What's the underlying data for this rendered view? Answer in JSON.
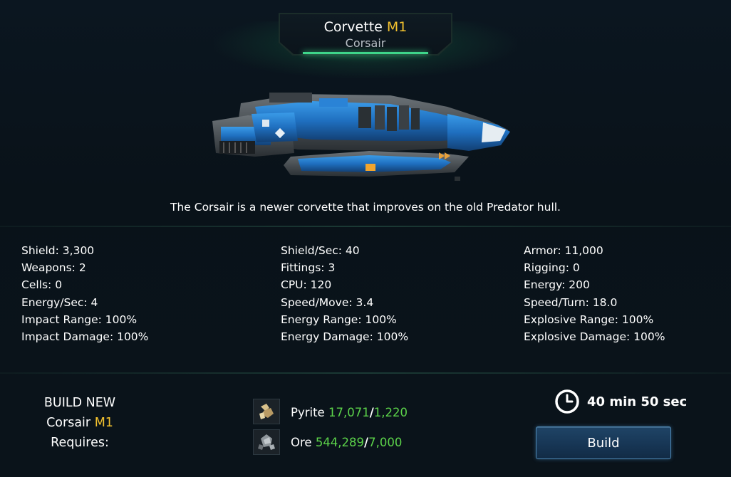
{
  "header": {
    "class_name": "Corvette",
    "mark": "M1",
    "ship_name": "Corsair"
  },
  "description": "The Corsair is a newer corvette that improves on the old Predator hull.",
  "stats": {
    "col1": [
      "Shield: 3,300",
      "Weapons: 2",
      "Cells: 0",
      "Energy/Sec: 4",
      "Impact Range: 100%",
      "Impact Damage: 100%"
    ],
    "col2": [
      "Shield/Sec: 40",
      "Fittings: 3",
      "CPU: 120",
      "Speed/Move: 3.4",
      "Energy Range: 100%",
      "Energy Damage: 100%"
    ],
    "col3": [
      "Armor: 11,000",
      "Rigging: 0",
      "Energy: 200",
      "Speed/Turn: 18.0",
      "Explosive Range: 100%",
      "Explosive Damage: 100%"
    ]
  },
  "build": {
    "line1": "BUILD NEW",
    "ship_name": "Corsair",
    "mark": "M1",
    "requires": "Requires:",
    "resources": [
      {
        "name": "Pyrite",
        "owned": "17,071",
        "required": "1,220",
        "icon": "pyrite-icon"
      },
      {
        "name": "Ore",
        "owned": "544,289",
        "required": "7,000",
        "icon": "ore-icon"
      }
    ],
    "time": "40 min 50 sec",
    "button_label": "Build"
  },
  "colors": {
    "accent_gold": "#f2c12e",
    "resource_green": "#5cd34a",
    "ship_blue": "#1f74c4",
    "button_blue": "#1a3a5c"
  }
}
